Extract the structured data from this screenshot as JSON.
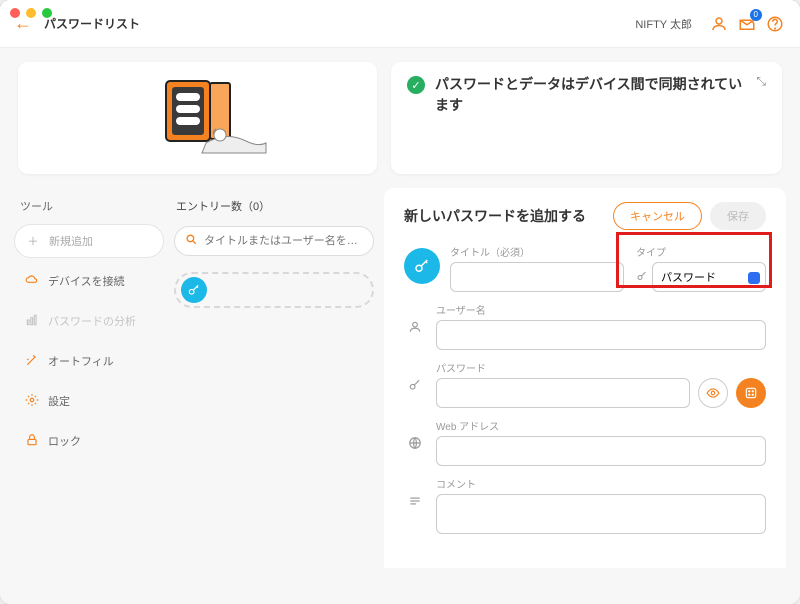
{
  "header": {
    "title": "パスワードリスト",
    "user": "NIFTY 太郎",
    "notification_count": "0"
  },
  "banner": {
    "sync_message": "パスワードとデータはデバイス間で同期されています"
  },
  "sidebar": {
    "section_label": "ツール",
    "items": [
      {
        "icon": "plus",
        "label": "新規追加"
      },
      {
        "icon": "cloud",
        "label": "デバイスを接続"
      },
      {
        "icon": "chart",
        "label": "パスワードの分析"
      },
      {
        "icon": "wand",
        "label": "オートフィル"
      },
      {
        "icon": "gear",
        "label": "設定"
      },
      {
        "icon": "lock",
        "label": "ロック"
      }
    ]
  },
  "center": {
    "entry_count_label": "エントリー数（0）",
    "search_placeholder": "タイトルまたはユーザー名を…"
  },
  "form": {
    "title": "新しいパスワードを追加する",
    "cancel": "キャンセル",
    "save": "保存",
    "fields": {
      "title_label": "タイトル（必須）",
      "type_label": "タイプ",
      "type_value": "パスワード",
      "username_label": "ユーザー名",
      "password_label": "パスワード",
      "web_label": "Web アドレス",
      "comment_label": "コメント"
    }
  }
}
